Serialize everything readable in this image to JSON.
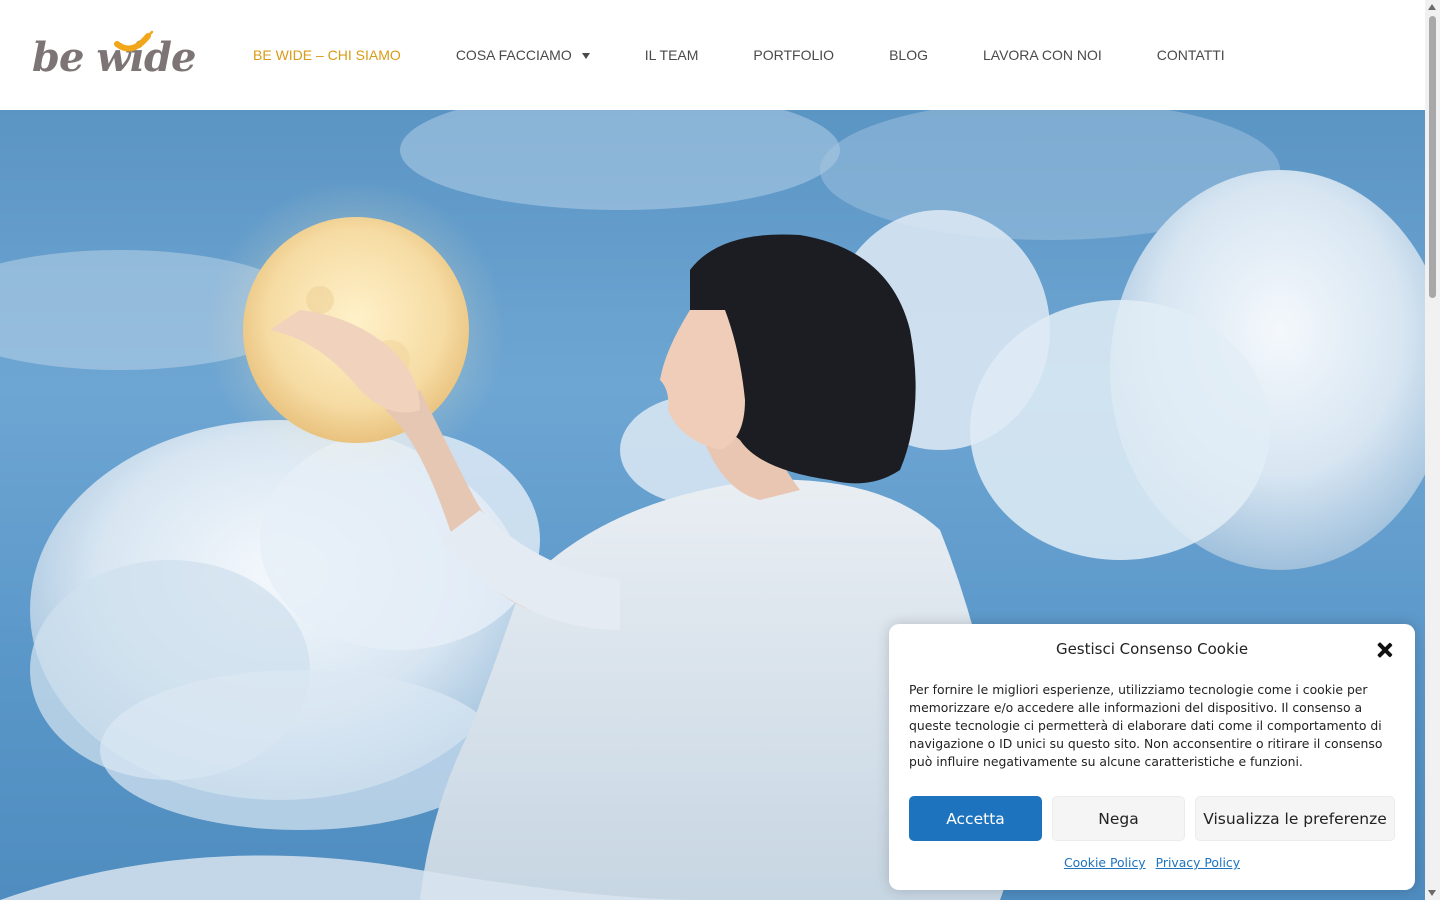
{
  "logo": {
    "text": "be wide",
    "accent_color": "#f2a71b"
  },
  "nav": {
    "items": [
      {
        "label": "BE WIDE – CHI SIAMO",
        "active": true
      },
      {
        "label": "COSA FACCIAMO",
        "has_dropdown": true
      },
      {
        "label": "IL TEAM"
      },
      {
        "label": "PORTFOLIO"
      },
      {
        "label": "BLOG"
      },
      {
        "label": "LAVORA CON NOI"
      },
      {
        "label": "CONTATTI"
      }
    ],
    "active_color": "#d89b17"
  },
  "hero": {
    "icon": "hero-image-woman-holding-moon"
  },
  "cookie": {
    "title": "Gestisci Consenso Cookie",
    "text": "Per fornire le migliori esperienze, utilizziamo tecnologie come i cookie per memorizzare e/o accedere alle informazioni del dispositivo. Il consenso a queste tecnologie ci permetterà di elaborare dati come il comportamento di navigazione o ID unici su questo sito. Non acconsentire o ritirare il consenso può influire negativamente su alcune caratteristiche e funzioni.",
    "accept_label": "Accetta",
    "deny_label": "Nega",
    "prefs_label": "Visualizza le preferenze",
    "cookie_policy_label": "Cookie Policy",
    "privacy_policy_label": "Privacy Policy",
    "accent_color": "#1e73be"
  }
}
